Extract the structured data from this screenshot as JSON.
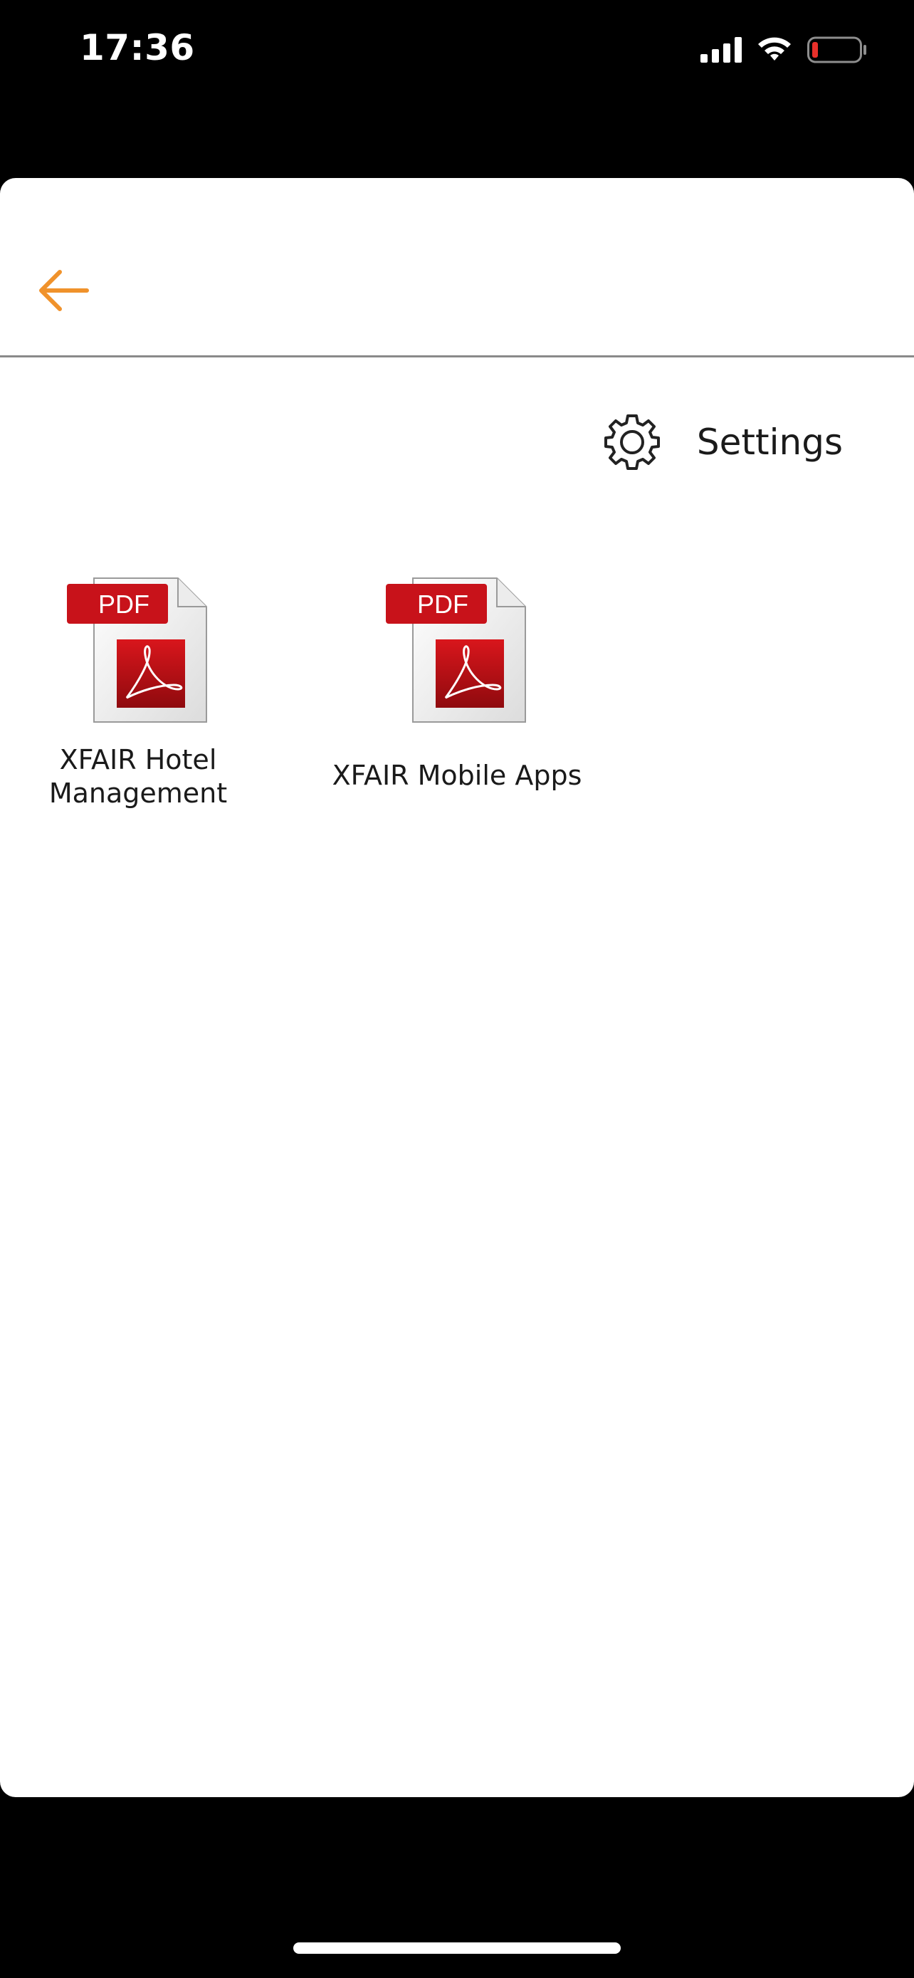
{
  "status_bar": {
    "time": "17:36",
    "icons": [
      "cellular-signal-icon",
      "wifi-icon",
      "battery-low-icon"
    ],
    "battery_color": "#e8302a"
  },
  "nav": {
    "back_icon": "arrow-left-icon",
    "accent_color": "#f0922b"
  },
  "settings": {
    "icon": "gear-icon",
    "label": "Settings"
  },
  "files": [
    {
      "badge": "PDF",
      "name": "XFAIR Hotel\nManagement",
      "icon": "pdf-file-icon"
    },
    {
      "badge": "PDF",
      "name": "XFAIR Mobile Apps",
      "icon": "pdf-file-icon"
    }
  ]
}
